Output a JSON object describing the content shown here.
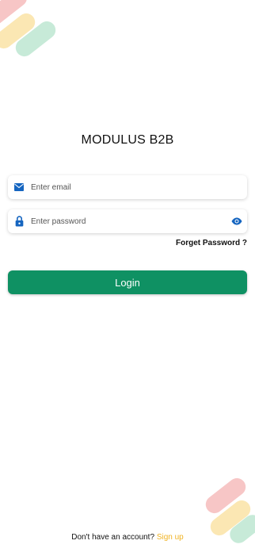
{
  "app": {
    "title": "MODULUS B2B"
  },
  "form": {
    "email_placeholder": "Enter email",
    "password_placeholder": "Enter password",
    "forgot_label": "Forget Password ?",
    "login_label": "Login"
  },
  "footer": {
    "question": "Don't have an account?",
    "signup_label": "Sign up"
  },
  "icons": {
    "email": "mail-icon",
    "password": "lock-icon",
    "visibility": "eye-icon"
  },
  "colors": {
    "primary": "#0f9163",
    "accent": "#f0b323",
    "field_icon": "#1565c0",
    "stripe_red": "#f7c6c6",
    "stripe_yellow": "#fbe7b3",
    "stripe_green": "#c7ead8"
  }
}
